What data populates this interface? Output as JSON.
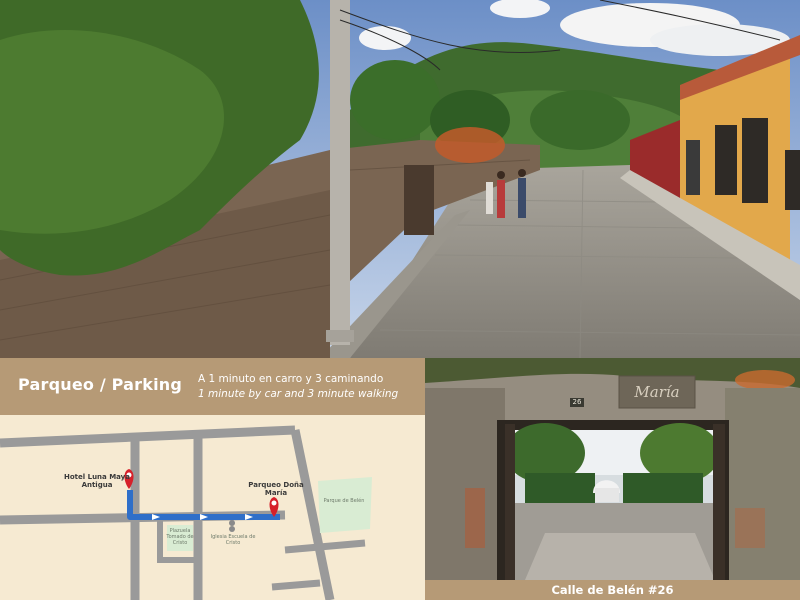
{
  "header": {
    "title": "Parqueo / Parking",
    "line_es": "A 1 minuto en carro y 3 caminando",
    "line_en": "1 minute by car and 3 minute walking"
  },
  "map": {
    "hotel_label": "Hotel Luna Maya Antigua",
    "parking_label": "Parqueo Doña María",
    "park_label": "Parque de Belén",
    "plazuela_label": "Plazuela Tomado de Cristo",
    "church_label": "Iglesia Escuela de Cristo",
    "route_color": "#2f6fc9",
    "pin_color": "#d6202a",
    "park_color": "#d9ecd3"
  },
  "gate_photo": {
    "street_number": "26",
    "sign_text": "María"
  },
  "address": {
    "text": "Calle de Belén #26"
  },
  "colors": {
    "band": "#b69a76",
    "map_bg": "#f6ead2",
    "street": "#9a9a9a"
  }
}
